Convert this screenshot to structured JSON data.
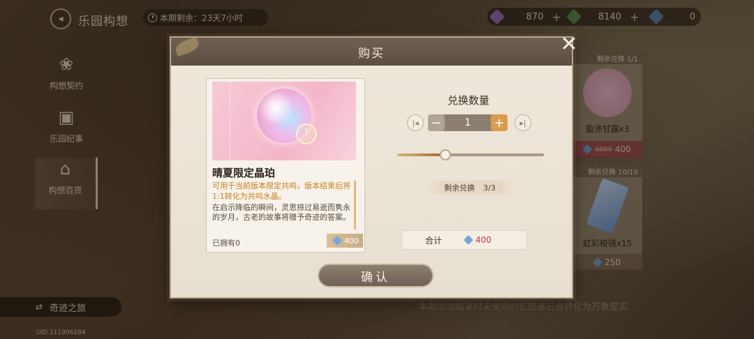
{
  "topbar": {
    "title": "乐园构想",
    "timer_text": "本期剩余：23天7小时",
    "currencies": [
      {
        "icon": "purple-crystal-icon",
        "value": "870",
        "color": "#9b6fc4"
      },
      {
        "icon": "green-gem-icon",
        "value": "8140",
        "color": "#5d8a4a"
      },
      {
        "icon": "blue-crystal-icon",
        "value": "0",
        "color": "#5f86b8"
      }
    ],
    "plus_symbol": "+"
  },
  "sidebar": {
    "items": [
      {
        "label": "构想契约",
        "icon": "lotus-icon"
      },
      {
        "label": "乐园纪事",
        "icon": "book-icon"
      },
      {
        "label": "构想百货",
        "icon": "shop-icon"
      }
    ],
    "journey_label": "奇迹之旅",
    "uid": "UID 111906284"
  },
  "background_shop": {
    "cards": [
      {
        "tag": "剩余兑换 1/1",
        "name": "盈沛甘露x3",
        "price_old": "4800",
        "price": "400"
      },
      {
        "tag": "剩余兑换 10/10",
        "name": "虹彩棱镜x15",
        "price_old": "",
        "price": "250"
      }
    ],
    "bottom_note": "本期活动结束时未使用的忆想基石会转化为万象星实"
  },
  "modal": {
    "title": "购买",
    "close_symbol": "✕",
    "item": {
      "name": "晴夏限定晶珀",
      "highlight": "可用于当前版本限定共鸣，版本结束后将1:1转化为共鸣水晶。",
      "lore": "在启示降临的瞬间，灵思掠过易逝而隽永的岁月，古老的故事将赠予奇迹的答案。",
      "owned": "已拥有0",
      "price": "400"
    },
    "quantity_title": "兑换数量",
    "quantity": "1",
    "minus_symbol": "−",
    "plus_symbol": "+",
    "skip_min_symbol": "|◂",
    "skip_max_symbol": "▸|",
    "slider_fraction": 0.33,
    "remaining_label": "剩余兑换",
    "remaining_value": "3/3",
    "total_label": "合计",
    "total_value": "400",
    "confirm_label": "确认"
  }
}
